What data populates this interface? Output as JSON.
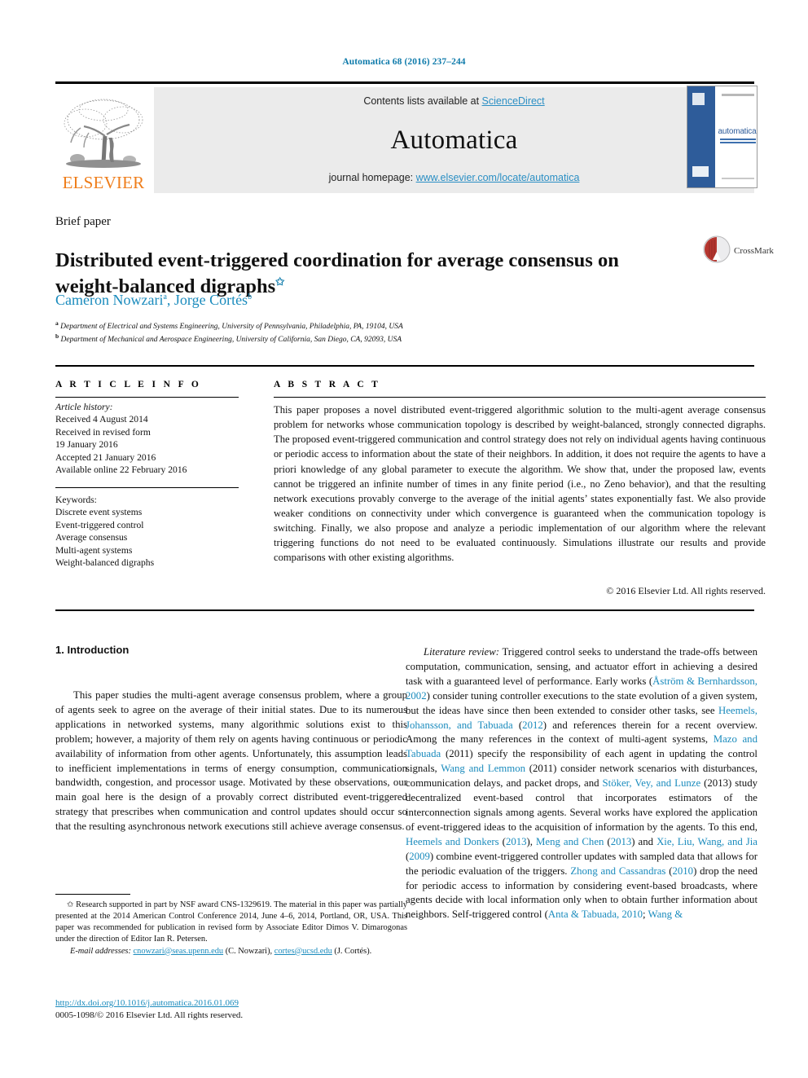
{
  "running_head": "Automatica 68 (2016) 237–244",
  "masthead": {
    "publisher": "ELSEVIER",
    "contents_prefix": "Contents lists available at ",
    "contents_link": "ScienceDirect",
    "journal_title": "Automatica",
    "homepage_prefix": "journal homepage: ",
    "homepage_url": "www.elsevier.com/locate/automatica",
    "cover_title": "automatica",
    "cover_alt": "automatica journal cover thumbnail"
  },
  "article": {
    "type_label": "Brief paper",
    "title": "Distributed event-triggered coordination for average consensus on weight-balanced digraphs",
    "title_marker": "✩",
    "authors": "Cameron Nowzari",
    "author_a_sup": "a",
    "author_2": "Jorge Cortés",
    "author_b_sup": "b",
    "affiliation_a_sup": "a",
    "affiliation_a": "Department of Electrical and Systems Engineering, University of Pennsylvania, Philadelphia, PA, 19104, USA",
    "affiliation_b_sup": "b",
    "affiliation_b": "Department of Mechanical and Aerospace Engineering, University of California, San Diego, CA, 92093, USA",
    "crossmark_label": "CrossMark"
  },
  "info": {
    "heading": "A R T I C L E   I N F O",
    "history_label": "Article history:",
    "history": [
      "Received 4 August 2014",
      "Received in revised form",
      "19 January 2016",
      "Accepted 21 January 2016",
      "Available online 22 February 2016"
    ],
    "keywords_label": "Keywords:",
    "keywords": [
      "Discrete event systems",
      "Event-triggered control",
      "Average consensus",
      "Multi-agent systems",
      "Weight-balanced digraphs"
    ]
  },
  "abstract": {
    "heading": "A B S T R A C T",
    "text": "This paper proposes a novel distributed event-triggered algorithmic solution to the multi-agent average consensus problem for networks whose communication topology is described by weight-balanced, strongly connected digraphs. The proposed event-triggered communication and control strategy does not rely on individual agents having continuous or periodic access to information about the state of their neighbors. In addition, it does not require the agents to have a priori knowledge of any global parameter to execute the algorithm. We show that, under the proposed law, events cannot be triggered an infinite number of times in any finite period (i.e., no Zeno behavior), and that the resulting network executions provably converge to the average of the initial agents’ states exponentially fast. We also provide weaker conditions on connectivity under which convergence is guaranteed when the communication topology is switching. Finally, we also propose and analyze a periodic implementation of our algorithm where the relevant triggering functions do not need to be evaluated continuously. Simulations illustrate our results and provide comparisons with other existing algorithms.",
    "copyright": "© 2016 Elsevier Ltd. All rights reserved."
  },
  "body": {
    "section_heading": "1. Introduction",
    "left_paragraph": "This paper studies the multi-agent average consensus problem, where a group of agents seek to agree on the average of their initial states. Due to its numerous applications in networked systems, many algorithmic solutions exist to this problem; however, a majority of them rely on agents having continuous or periodic availability of information from other agents. Unfortunately, this assumption leads to inefficient implementations in terms of energy consumption, communication bandwidth, congestion, and processor usage. Motivated by these observations, our main goal here is the design of a provably correct distributed event-triggered strategy that prescribes when communication and control updates should occur so that the resulting asynchronous network executions still achieve average consensus.",
    "right_lead_italic": "Literature review:",
    "right_paragraph_parts": [
      " Triggered control seeks to understand the trade-offs between computation, communication, sensing, and actuator effort in achieving a  desired task with a guaranteed level of performance. Early works (",
      "Åström & Bernhardsson, 2002",
      ") consider tuning controller executions to the state evolution of a given system, but the ideas have since then been extended to consider other tasks, see ",
      "Heemels, Johansson, and Tabuada",
      " (",
      "2012",
      ") and references therein for a recent overview. Among the many references in the context of multi-agent systems, ",
      "Mazo and Tabuada",
      " (2011) specify the responsibility of each agent in updating the control signals, ",
      "Wang and Lemmon",
      " (2011) consider network scenarios with disturbances, communication delays, and packet drops, and ",
      "Stöker, Vey, and Lunze",
      " (2013) study decentralized event-based control that incorporates estimators of the interconnection signals among agents. Several works have explored the application of event-triggered ideas to the acquisition of information by the agents. To this end, ",
      "Heemels and Donkers",
      " (",
      "2013",
      "), ",
      "Meng and Chen",
      " (",
      "2013",
      ") and ",
      "Xie, Liu, Wang, and Jia",
      " (",
      "2009",
      ") combine event-triggered controller updates with sampled data that allows for the periodic evaluation of the triggers. ",
      "Zhong and Cassandras",
      " (",
      "2010",
      ") drop the need for periodic access to information by considering event-based broadcasts, where agents decide with local information only when to obtain further information about neighbors. Self-triggered control (",
      "Anta & Tabuada, 2010",
      "; ",
      "Wang &"
    ]
  },
  "footnote": {
    "marker": "✩",
    "text": " Research supported in part by NSF award CNS-1329619. The material in this paper was partially presented at the 2014 American Control Conference 2014, June 4–6, 2014, Portland, OR, USA. This paper was recommended for publication in revised form by Associate Editor Dimos V. Dimarogonas under the direction of Editor Ian R. Petersen.",
    "email_label": "E-mail addresses:",
    "email_1": "cnowzari@seas.upenn.edu",
    "email_1_owner": " (C. Nowzari), ",
    "email_2": "cortes@ucsd.edu",
    "email_2_owner": " (J. Cortés)."
  },
  "doi_block": {
    "doi_url": "http://dx.doi.org/10.1016/j.automatica.2016.01.069",
    "issn_line": "0005-1098/© 2016 Elsevier Ltd. All rights reserved."
  },
  "colors": {
    "link_blue": "#1a8bbd",
    "header_blue": "#0f7bab",
    "elsevier_orange": "#ef7d1a",
    "banner_grey": "#ebebeb",
    "cover_blue": "#2e5c9a"
  }
}
